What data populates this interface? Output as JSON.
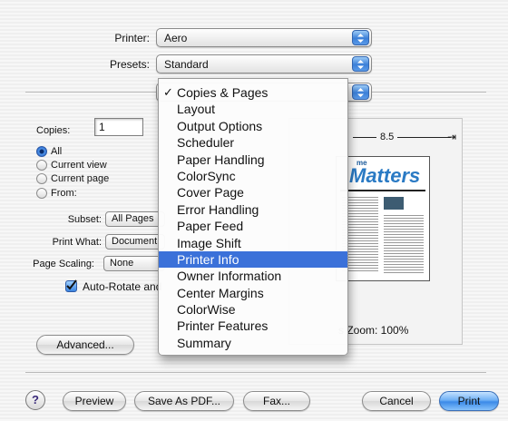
{
  "printer": {
    "label": "Printer:",
    "value": "Aero"
  },
  "presets": {
    "label": "Presets:",
    "value": "Standard"
  },
  "copies": {
    "label": "Copies:",
    "value": "1"
  },
  "pages": {
    "options": [
      "All",
      "Current view",
      "Current page",
      "From:"
    ],
    "selected": "All"
  },
  "subset": {
    "label": "Subset:",
    "value": "All Pages"
  },
  "print_what": {
    "label": "Print What:",
    "value": "Document"
  },
  "page_scaling": {
    "label": "Page Scaling:",
    "value": "None"
  },
  "auto_rotate": {
    "label": "Auto-Rotate and",
    "checked": true
  },
  "preview": {
    "width_label": "8.5",
    "brand_small": "me",
    "brand_big": "Matters",
    "zoom_text": "s Zoom: 100%"
  },
  "menu": {
    "items": [
      "Copies & Pages",
      "Layout",
      "Output Options",
      "Scheduler",
      "Paper Handling",
      "ColorSync",
      "Cover Page",
      "Error Handling",
      "Paper Feed",
      "Image Shift",
      "Printer Info",
      "Owner Information",
      "Center Margins",
      "ColorWise",
      "Printer Features",
      "Summary"
    ],
    "checked": "Copies & Pages",
    "highlighted": "Printer Info"
  },
  "buttons": {
    "advanced": "Advanced...",
    "help": "?",
    "preview": "Preview",
    "save_pdf": "Save As PDF...",
    "fax": "Fax...",
    "cancel": "Cancel",
    "print": "Print"
  },
  "colors": {
    "accent": "#3b71d9",
    "default_button": "#6fb0f5"
  }
}
